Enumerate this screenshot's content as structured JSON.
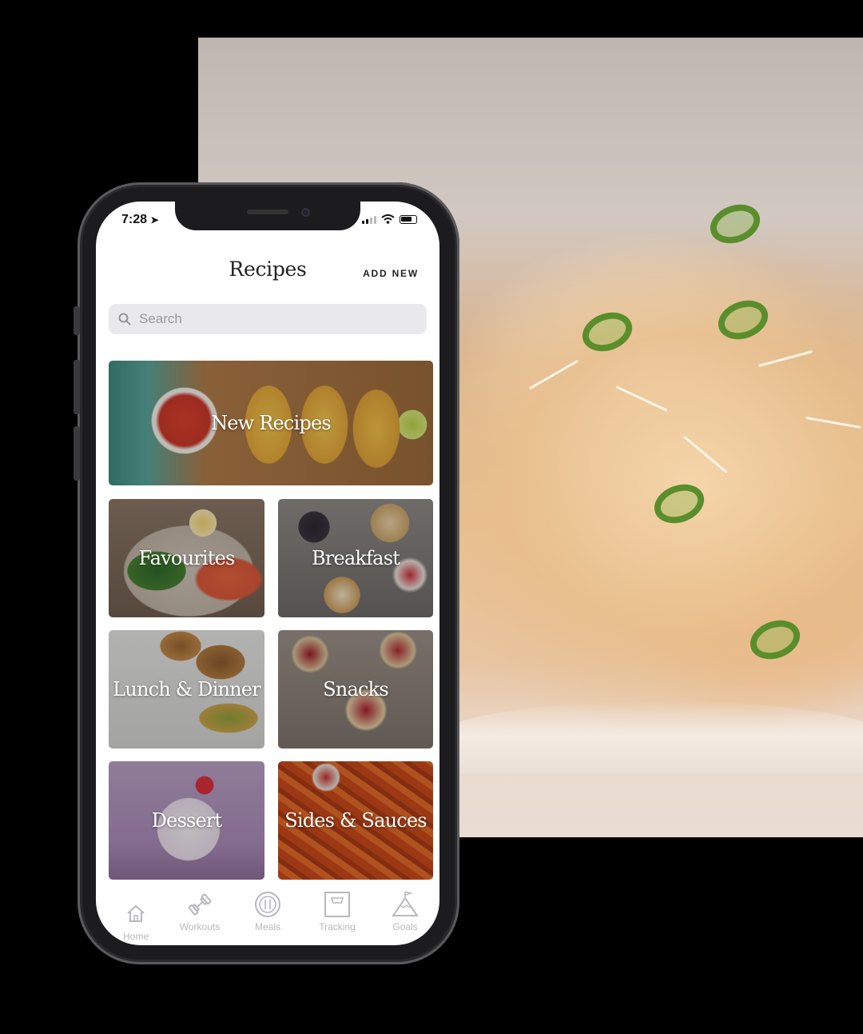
{
  "status_bar": {
    "time": "7:28",
    "location_arrow": "location-arrow-icon"
  },
  "header": {
    "title": "Recipes",
    "add_new_label": "ADD NEW"
  },
  "search": {
    "placeholder": "Search"
  },
  "categories": [
    {
      "label": "New Recipes"
    },
    {
      "label": "Favourites"
    },
    {
      "label": "Breakfast"
    },
    {
      "label": "Lunch & Dinner"
    },
    {
      "label": "Snacks"
    },
    {
      "label": "Dessert"
    },
    {
      "label": "Sides & Sauces"
    }
  ],
  "tabbar": {
    "items": [
      {
        "label": "Home",
        "icon": "home-icon"
      },
      {
        "label": "Workouts",
        "icon": "dumbbell-icon"
      },
      {
        "label": "Meals",
        "icon": "plate-icon"
      },
      {
        "label": "Tracking",
        "icon": "scale-icon"
      },
      {
        "label": "Goals",
        "icon": "mountain-flag-icon"
      }
    ]
  },
  "colors": {
    "tab_inactive": "#b8b8bc",
    "header_text": "#222222",
    "search_bg": "#e9e9eb"
  }
}
